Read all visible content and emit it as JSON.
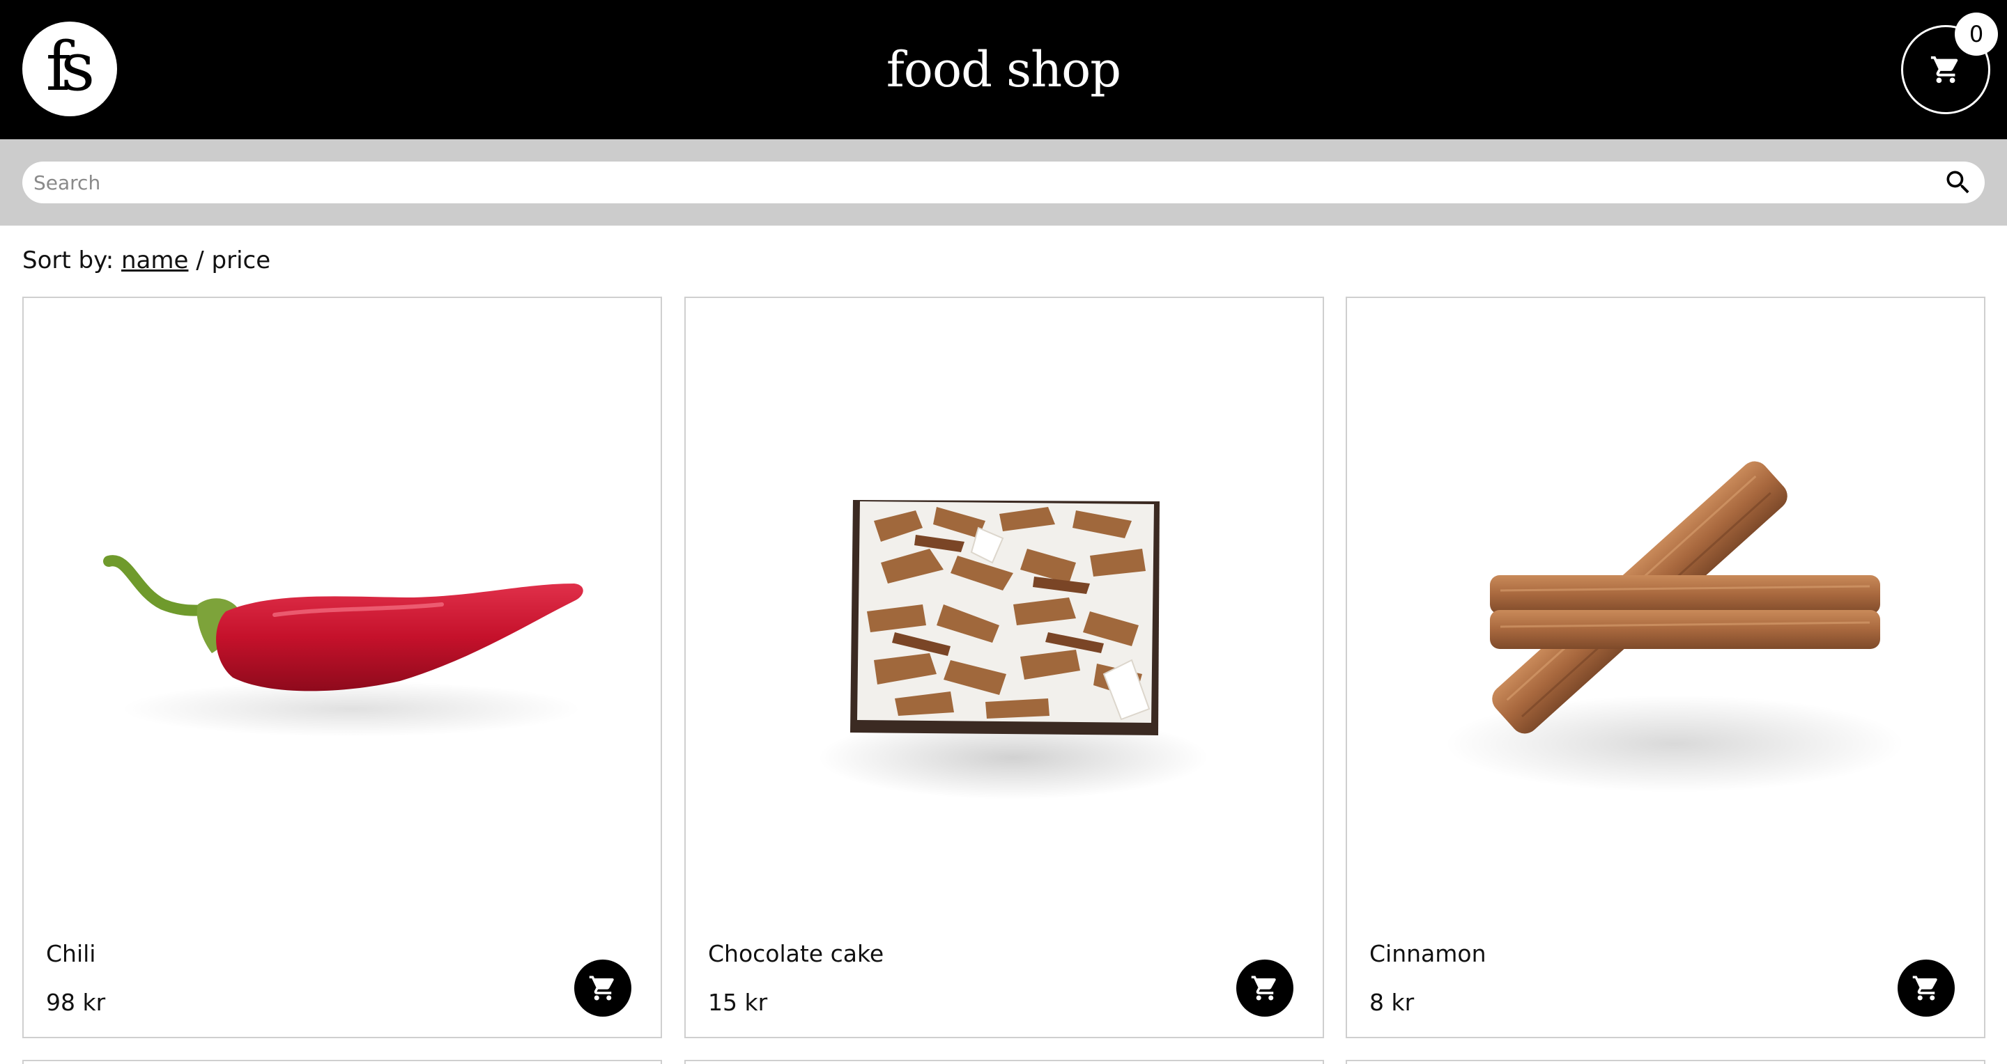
{
  "header": {
    "logo_text": "fs",
    "title": "food shop",
    "cart_count": "0"
  },
  "search": {
    "placeholder": "Search"
  },
  "sort": {
    "label": "Sort by:",
    "option_name": "name",
    "separator": "/",
    "option_price": "price"
  },
  "products": [
    {
      "name": "Chili",
      "price": "98 kr",
      "image": "chili-pepper"
    },
    {
      "name": "Chocolate cake",
      "price": "15 kr",
      "image": "chocolate-cake"
    },
    {
      "name": "Cinnamon",
      "price": "8 kr",
      "image": "cinnamon-sticks"
    }
  ],
  "colors": {
    "header_bg": "#000000",
    "search_bar_bg": "#cccccc",
    "card_border": "#cfcfcf"
  }
}
